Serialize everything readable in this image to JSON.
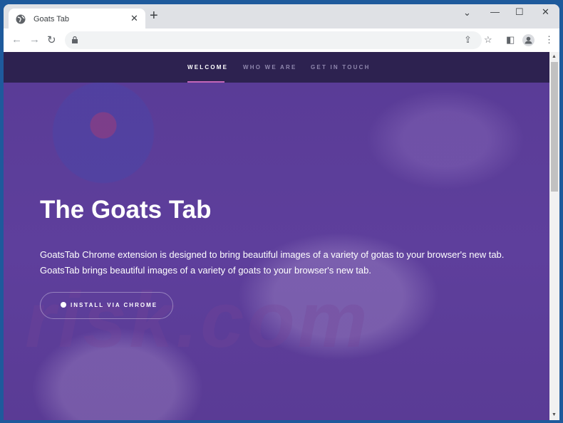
{
  "browser": {
    "tab_title": "Goats Tab",
    "tab_close": "✕",
    "new_tab": "+",
    "window_controls": {
      "dropdown": "⌄",
      "minimize": "—",
      "maximize": "☐",
      "close": "✕"
    },
    "nav": {
      "back": "←",
      "forward": "→",
      "reload": "↻"
    },
    "url": "",
    "icons": [
      "lock-icon",
      "share-icon",
      "star-icon",
      "sidepanel-icon",
      "profile-icon",
      "menu-icon"
    ]
  },
  "site": {
    "nav": [
      {
        "label": "WELCOME",
        "active": true
      },
      {
        "label": "WHO WE ARE",
        "active": false
      },
      {
        "label": "GET IN TOUCH",
        "active": false
      }
    ],
    "hero": {
      "title": "The Goats Tab",
      "line1": "GoatsTab Chrome extension is designed to bring beautiful images of a variety of gotas to your browser's new tab.",
      "line2": "GoatsTab brings beautiful images of a variety of goats to your browser's new tab.",
      "button": "INSTALL VIA CHROME"
    },
    "watermark": "risk.com"
  },
  "colors": {
    "nav_bg": "#2d2250",
    "hero_bg": "#5b3d96",
    "accent": "#c466b8"
  }
}
